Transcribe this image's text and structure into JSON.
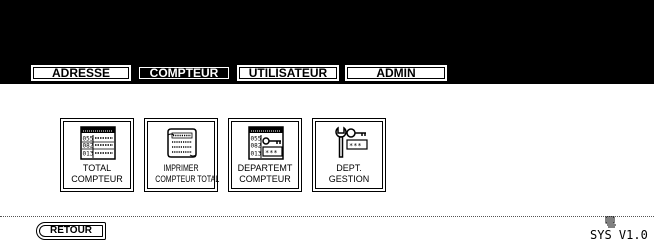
{
  "tabs": [
    {
      "label": "ADRESSE",
      "active": false
    },
    {
      "label": "COMPTEUR",
      "active": true
    },
    {
      "label": "UTILISATEUR",
      "active": false
    },
    {
      "label": "ADMIN",
      "active": false
    }
  ],
  "menu": [
    {
      "lines": [
        "TOTAL",
        "COMPTEUR"
      ],
      "icon": "total-counter-icon"
    },
    {
      "lines": [
        "IMPRIMER",
        "COMPTEUR TOTAL"
      ],
      "icon": "print-counter-icon"
    },
    {
      "lines": [
        "DEPARTEMT",
        "COMPTEUR"
      ],
      "icon": "department-counter-icon"
    },
    {
      "lines": [
        "DEPT.",
        "GESTION"
      ],
      "icon": "department-management-icon"
    }
  ],
  "icon_text": {
    "counter_codes": [
      "055",
      "082",
      "013"
    ],
    "stars": "***"
  },
  "footer": {
    "back_label": "RETOUR",
    "version": "SYS V1.0",
    "status_icon": "machine-status-icon"
  }
}
